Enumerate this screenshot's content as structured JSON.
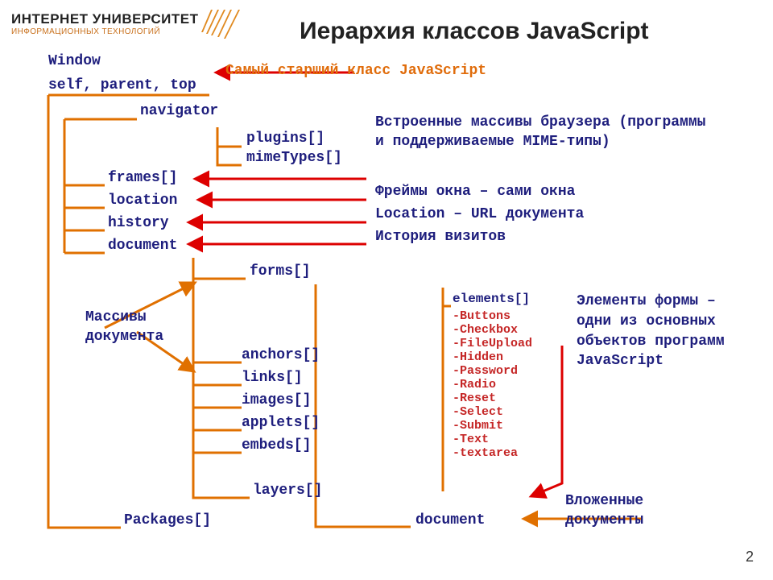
{
  "header": {
    "logo_top": "ИНТЕРНЕТ УНИВЕРСИТЕТ",
    "logo_sub": "ИНФОРМАЦИОННЫХ ТЕХНОЛОГИЙ",
    "title": "Иерархия классов JavaScript"
  },
  "root": {
    "window": "Window",
    "self": "self, parent, top",
    "navigator": "navigator",
    "plugins": "plugins[]",
    "mimetypes": "mimeTypes[]",
    "frames": "frames[]",
    "location": "location",
    "history": "history",
    "document": "document",
    "forms": "forms[]",
    "anchors": "anchors[]",
    "links": "links[]",
    "images": "images[]",
    "applets": "applets[]",
    "embeds": "embeds[]",
    "layers": "layers[]",
    "packages": "Packages[]",
    "document2": "document"
  },
  "elements": {
    "header": "elements[]",
    "list": [
      "-Buttons",
      "-Checkbox",
      "-FileUpload",
      "-Hidden",
      "-Password",
      "-Radio",
      "-Reset",
      "-Select",
      "-Submit",
      "-Text",
      "-textarea"
    ]
  },
  "notes": {
    "topmost": "Самый старший класс JavaScript",
    "arrays": "Встроенные массивы браузера (программы и поддерживаемые MIME-типы)",
    "frames": "Фреймы окна – сами окна",
    "location": "Location – URL документа",
    "history": "История визитов",
    "docarrays": "Массивы документа",
    "formelems": "Элементы формы – одни из основных объектов программ JavaScript",
    "nested": "Вложенные документы"
  },
  "page": "2"
}
